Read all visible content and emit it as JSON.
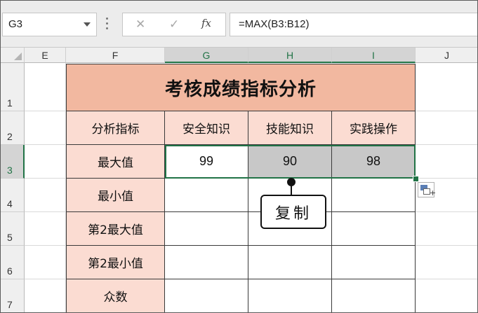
{
  "formula_bar": {
    "name_box": "G3",
    "cancel_symbol": "✕",
    "enter_symbol": "✓",
    "fx_symbol": "fx",
    "formula": "=MAX(B3:B12)"
  },
  "columns": [
    "E",
    "F",
    "G",
    "H",
    "I",
    "J"
  ],
  "rows": [
    "1",
    "2",
    "3",
    "4",
    "5",
    "6",
    "7"
  ],
  "table": {
    "title": "考核成绩指标分析",
    "header": [
      "分析指标",
      "安全知识",
      "技能知识",
      "实践操作"
    ],
    "row_labels": [
      "最大值",
      "最小值",
      "第2最大值",
      "第2最小值",
      "众数"
    ],
    "max_values": [
      "99",
      "90",
      "98"
    ]
  },
  "callout": {
    "text": "复制"
  },
  "colors": {
    "title_fill": "#f2b8a0",
    "label_fill": "#fbdcd2",
    "copied_fill": "#c8c8c8",
    "selection_green": "#217346"
  }
}
